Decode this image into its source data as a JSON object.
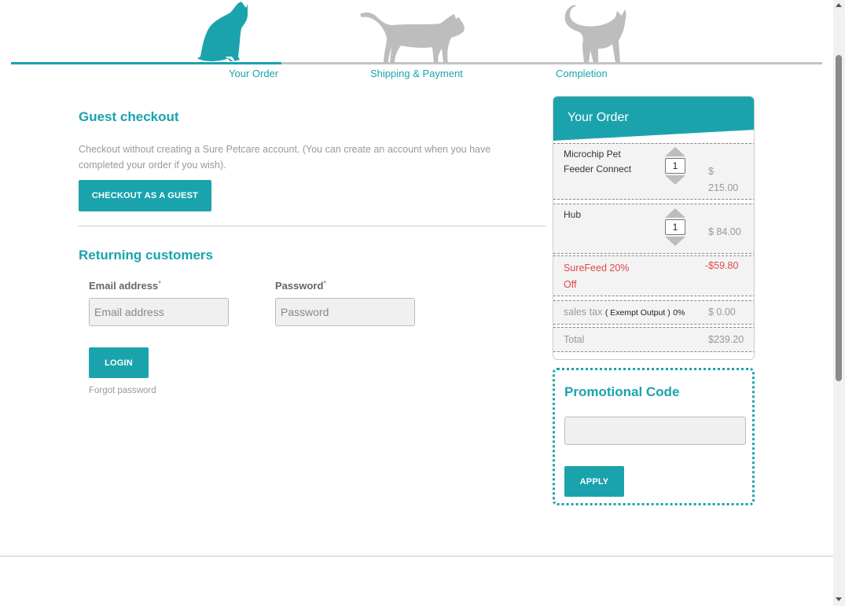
{
  "steps": [
    {
      "label": "Your Order"
    },
    {
      "label": "Shipping & Payment"
    },
    {
      "label": "Completion"
    }
  ],
  "guest": {
    "title": "Guest checkout",
    "description": "Checkout without creating a Sure Petcare account. (You can create an account when you have completed your order if you wish).",
    "button_label": "CHECKOUT AS A GUEST"
  },
  "returning": {
    "title": "Returning customers",
    "email_label": "Email address",
    "email_placeholder": "Email address",
    "email_value": "",
    "password_label": "Password",
    "password_placeholder": "Password",
    "password_value": "",
    "required_mark": "*",
    "login_label": "LOGIN",
    "forgot_label": "Forgot password"
  },
  "order": {
    "title": "Your Order",
    "items": [
      {
        "name": "Microchip Pet Feeder Connect",
        "qty": "1",
        "price": "$ 215.00"
      },
      {
        "name": "Hub",
        "qty": "1",
        "price": "$ 84.00"
      }
    ],
    "discount": {
      "name": "SureFeed 20% Off",
      "amount": "-$59.80"
    },
    "tax": {
      "label": "sales tax",
      "note": "( Exempt Output )",
      "rate": "0%",
      "amount": "$ 0.00"
    },
    "total": {
      "label": "Total",
      "amount": "$239.20"
    }
  },
  "promo": {
    "title": "Promotional Code",
    "value": "",
    "button_label": "APPLY"
  },
  "colors": {
    "accent": "#1aa3ad",
    "discount": "#e0474c",
    "inactive": "#c4c4c4"
  },
  "icons": [
    "cat-sitting-icon",
    "cat-walking-icon",
    "cat-standing-icon",
    "scroll-up-icon",
    "scroll-down-icon"
  ]
}
